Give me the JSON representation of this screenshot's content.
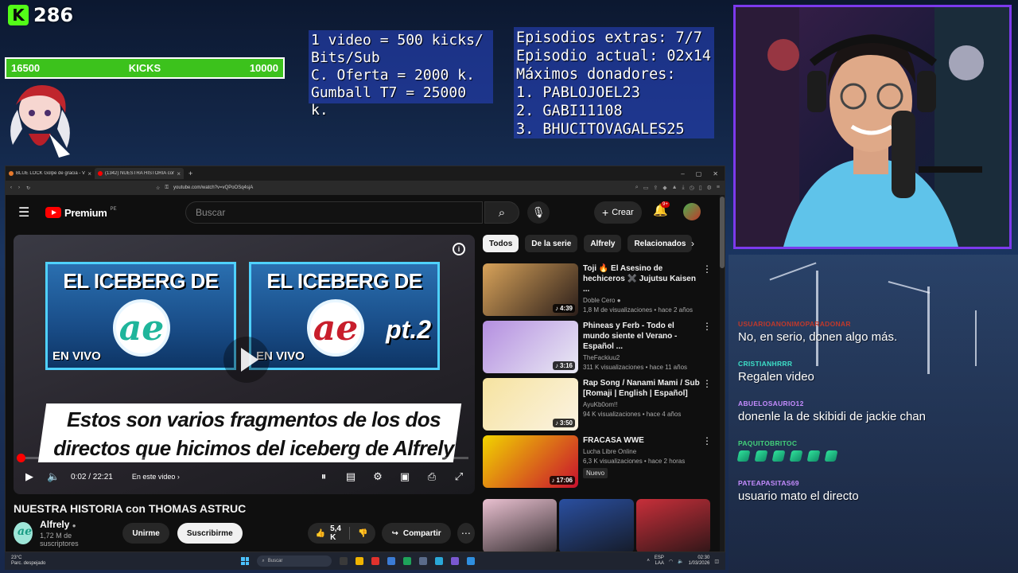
{
  "overlay": {
    "kick_logo": "K",
    "kick_count": "286",
    "goal_bar": {
      "left": "16500",
      "label": "KICKS",
      "right": "10000"
    },
    "info_left": [
      "1 video = 500 kicks/",
      "Bits/Sub",
      "C. Oferta = 2000 k.",
      "Gumball T7 = 25000 k."
    ],
    "info_right": [
      "Episodios extras: 7/7",
      "Episodio actual: 02x14",
      "Máximos donadores:",
      "1. PABLOJOEL23",
      "2. GABI11108",
      "3. BHUCITOVAGALES25"
    ]
  },
  "browser": {
    "tabs": [
      {
        "label": "BLUE LOCK Golpe de gracia - Ve",
        "active": false
      },
      {
        "label": "(1342) NUESTRA HISTORIA con",
        "active": true
      }
    ],
    "new_tab": "+",
    "win_controls": [
      "–",
      "▢",
      "✕"
    ],
    "url": "youtube.com/watch?v=vQPoOSq4sjA"
  },
  "youtube": {
    "logo_text": "Premium",
    "logo_region": "PE",
    "search_placeholder": "Buscar",
    "create_label": "Crear",
    "notif_badge": "9+",
    "player": {
      "thumb1_title": "EL ICEBERG DE",
      "thumb1_sub": "EN VIVO",
      "thumb2_title": "EL ICEBERG DE",
      "thumb2_sub": "EN VIVO",
      "thumb2_tag": "pt.2",
      "logo_glyph": "ae",
      "caption_line1": "Estos son varios fragmentos de los dos",
      "caption_line2": "directos que hicimos del iceberg de Alfrely",
      "progress": 0.0015,
      "current_time": "0:02 / 22:21",
      "chapter_label": "En este video",
      "info_icon": "i"
    },
    "video_title": "NUESTRA HISTORIA con THOMAS ASTRUC",
    "channel": {
      "name": "Alfrely",
      "subs": "1,72 M de suscriptores",
      "leave_label": "Unirme",
      "subscribe_label": "Suscribirme"
    },
    "likes": "5,4 K",
    "share_label": "Compartir",
    "chips": [
      "Todos",
      "De la serie",
      "Alfrely",
      "Relacionados"
    ],
    "recommendations": [
      {
        "title": "Toji 🔥 El Asesino de hechiceros ✖️ Jujutsu Kaisen ...",
        "channel": "Doble Cero",
        "verified": true,
        "meta": "1,8 M de visualizaciones • hace 2 años",
        "duration": "4:39",
        "badge": "",
        "color_a": "#d8a35a",
        "color_b": "#2b1e1a"
      },
      {
        "title": "Phineas y Ferb - Todo el mundo siente el Verano - Español ...",
        "channel": "TheFackiuu2",
        "verified": false,
        "meta": "311 K visualizaciones • hace 11 años",
        "duration": "3:16",
        "badge": "",
        "color_a": "#b48ee0",
        "color_b": "#eaeaf4"
      },
      {
        "title": "Rap Song / Nanami Mami / Sub [Romaji | English | Español]",
        "channel": "AyuKb0om!!",
        "verified": false,
        "meta": "94 K visualizaciones • hace 4 años",
        "duration": "3:50",
        "badge": "",
        "color_a": "#f6e3a0",
        "color_b": "#fbf3e2"
      },
      {
        "title": "FRACASA WWE",
        "channel": "Lucha Libre Online",
        "verified": false,
        "meta": "6,3 K visualizaciones • hace 2 horas",
        "duration": "17:06",
        "badge": "Nuevo",
        "color_a": "#f1d400",
        "color_b": "#c8102e"
      }
    ],
    "shorts_colors": [
      "#e9c0d0",
      "#2a4fa0",
      "#c82f3a"
    ]
  },
  "taskbar": {
    "weather_temp": "23°C",
    "weather_desc": "Parc. despejado",
    "search_label": "Buscar",
    "lang": "ESP",
    "lang2": "LAA",
    "time": "02:30",
    "date": "1/03/2026"
  },
  "chat": [
    {
      "user": "USUARIOANONIMOPARADONAR",
      "text": "No, en serio, donen algo más.",
      "color": "#c0392b"
    },
    {
      "user": "CRISTIANHRRR",
      "text": "Regalen video",
      "color": "#3de0c8"
    },
    {
      "user": "ABUELOSAURIO12",
      "text": "donenle la de skibidi de jackie chan",
      "color": "#c58cff"
    },
    {
      "user": "PAQUITOBRITOC",
      "text": "",
      "color": "#43d17a",
      "emotes": 6
    },
    {
      "user": "PATEAPASITAS69",
      "text": "usuario mato el directo",
      "color": "#c58cff"
    }
  ]
}
